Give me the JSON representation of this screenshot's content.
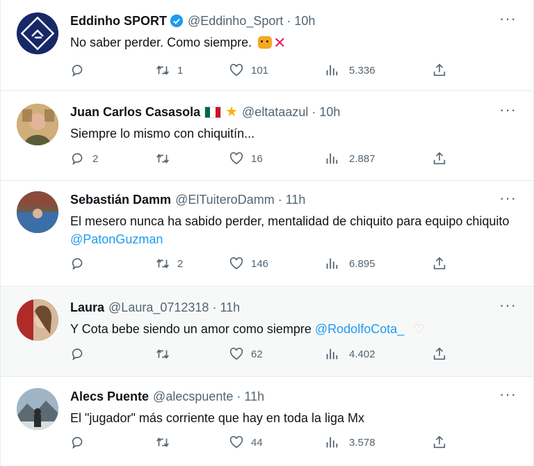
{
  "colors": {
    "accent": "#1d9bf0",
    "text": "#0f1419",
    "muted": "#536471",
    "highlight": "#f7f9f9"
  },
  "tweets": [
    {
      "name": "Eddinho SPORT",
      "handle": "@Eddinho_Sport",
      "time": "10h",
      "verified": true,
      "text": "No saber perder. Como siempre.",
      "mention": "",
      "replies": "",
      "retweets": "1",
      "likes": "101",
      "views": "5.336"
    },
    {
      "name": "Juan Carlos Casasola",
      "handle": "@eltataazul",
      "time": "10h",
      "text": "Siempre lo mismo con chiquitín...",
      "mention": "",
      "replies": "2",
      "retweets": "",
      "likes": "16",
      "views": "2.887"
    },
    {
      "name": "Sebastián Damm",
      "handle": "@ElTuiteroDamm",
      "time": "11h",
      "text": "El mesero nunca ha sabido perder, mentalidad de chiquito para equipo chiquito",
      "mention": "@PatonGuzman",
      "replies": "",
      "retweets": "2",
      "likes": "146",
      "views": "6.895"
    },
    {
      "name": "Laura",
      "handle": "@Laura_0712318",
      "time": "11h",
      "text": "Y Cota bebe siendo un amor como siempre",
      "mention": "@RodolfoCota_",
      "replies": "",
      "retweets": "",
      "likes": "62",
      "views": "4.402"
    },
    {
      "name": "Alecs Puente",
      "handle": "@alecspuente",
      "time": "11h",
      "text": "El \"jugador\" más corriente que hay en toda la liga Mx",
      "mention": "",
      "replies": "",
      "retweets": "",
      "likes": "44",
      "views": "3.578"
    }
  ],
  "icons": [
    "reply-icon",
    "retweet-icon",
    "like-icon",
    "views-icon",
    "share-icon",
    "more-icon",
    "verified-badge-icon"
  ],
  "more_glyph": "···"
}
